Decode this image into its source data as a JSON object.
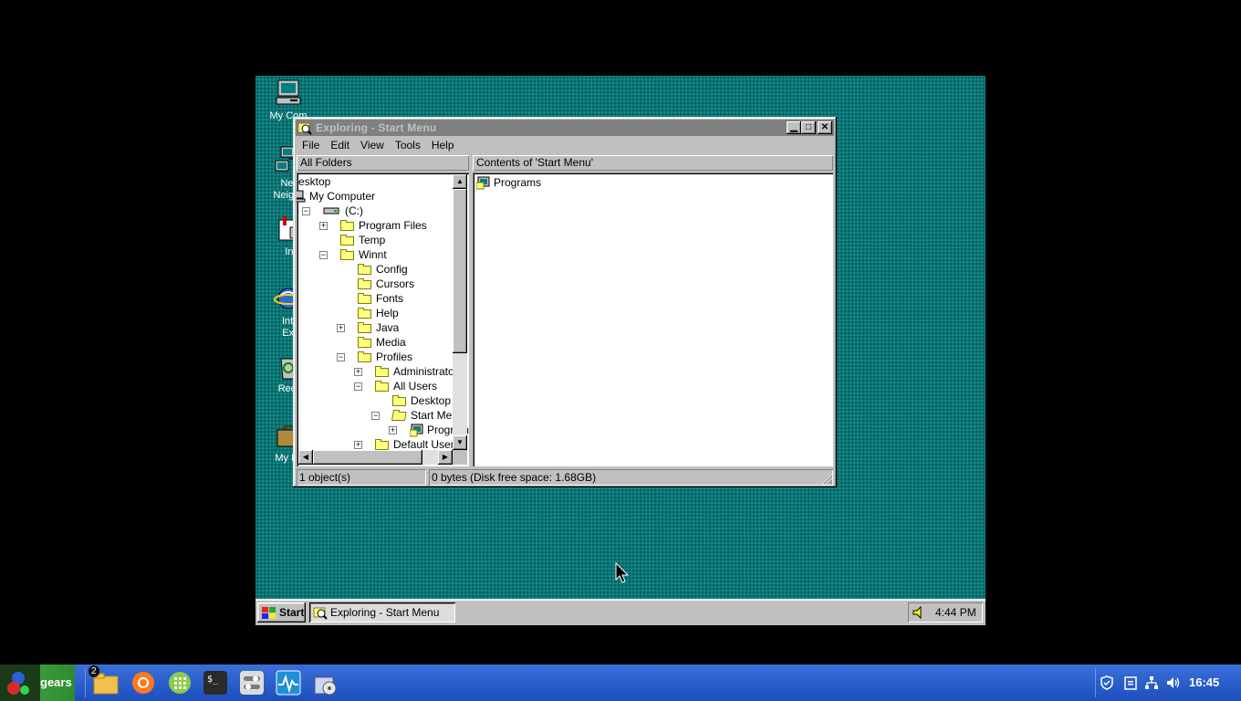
{
  "desktop_icons": [
    {
      "label": "My Com",
      "icon": "my-computer-icon"
    },
    {
      "label": "Netw\nNeighbo",
      "icon": "network-neighborhood-icon"
    },
    {
      "label": "Inb",
      "icon": "inbox-icon"
    },
    {
      "label": "Inter\nExpl",
      "icon": "internet-explorer-icon"
    },
    {
      "label": "Recyc",
      "icon": "recycle-bin-icon"
    },
    {
      "label": "My Brie",
      "icon": "my-briefcase-icon"
    }
  ],
  "window": {
    "title": "Exploring - Start Menu",
    "menu": [
      "File",
      "Edit",
      "View",
      "Tools",
      "Help"
    ],
    "left_header": "All Folders",
    "right_header": "Contents of 'Start Menu'",
    "tree": [
      {
        "label": "esktop",
        "level": 0,
        "expander": "",
        "icon": "none"
      },
      {
        "label": "My Computer",
        "level": 0,
        "expander": "",
        "icon": "computer"
      },
      {
        "label": "(C:)",
        "level": 1,
        "expander": "-",
        "icon": "drive"
      },
      {
        "label": "Program Files",
        "level": 2,
        "expander": "+",
        "icon": "folder"
      },
      {
        "label": "Temp",
        "level": 2,
        "expander": "",
        "icon": "folder"
      },
      {
        "label": "Winnt",
        "level": 2,
        "expander": "-",
        "icon": "folder"
      },
      {
        "label": "Config",
        "level": 3,
        "expander": "",
        "icon": "folder"
      },
      {
        "label": "Cursors",
        "level": 3,
        "expander": "",
        "icon": "folder"
      },
      {
        "label": "Fonts",
        "level": 3,
        "expander": "",
        "icon": "folder"
      },
      {
        "label": "Help",
        "level": 3,
        "expander": "",
        "icon": "folder"
      },
      {
        "label": "Java",
        "level": 3,
        "expander": "+",
        "icon": "folder"
      },
      {
        "label": "Media",
        "level": 3,
        "expander": "",
        "icon": "folder"
      },
      {
        "label": "Profiles",
        "level": 3,
        "expander": "-",
        "icon": "folder"
      },
      {
        "label": "Administrator",
        "level": 4,
        "expander": "+",
        "icon": "folder"
      },
      {
        "label": "All Users",
        "level": 4,
        "expander": "-",
        "icon": "folder"
      },
      {
        "label": "Desktop",
        "level": 5,
        "expander": "",
        "icon": "folder"
      },
      {
        "label": "Start Menu",
        "level": 5,
        "expander": "-",
        "icon": "folder-open"
      },
      {
        "label": "Programs",
        "level": 6,
        "expander": "+",
        "icon": "programs"
      },
      {
        "label": "Default User",
        "level": 4,
        "expander": "+",
        "icon": "folder"
      }
    ],
    "contents": [
      {
        "label": "Programs",
        "icon": "programs-group-icon"
      }
    ],
    "status_left": "1 object(s)",
    "status_right": "0 bytes (Disk free space: 1.68GB)"
  },
  "guest_taskbar": {
    "start_label": "Start",
    "task_label": "Exploring - Start Menu",
    "clock": "4:44 PM"
  },
  "host_panel": {
    "menu_label": "gears",
    "file_manager_badge": "2",
    "clock": "16:45",
    "apps": [
      "file-manager-icon",
      "firefox-icon",
      "spreadsheet-icon",
      "terminal-icon",
      "settings-toggle-icon",
      "system-monitor-icon",
      "package-manager-icon"
    ],
    "tray": [
      "shield-icon",
      "clipboard-icon",
      "network-icon",
      "volume-icon"
    ]
  },
  "colors": {
    "desktop": "#0f7d7d",
    "host_panel": "#2d5fcc",
    "titlebar_inactive": "#808080"
  }
}
